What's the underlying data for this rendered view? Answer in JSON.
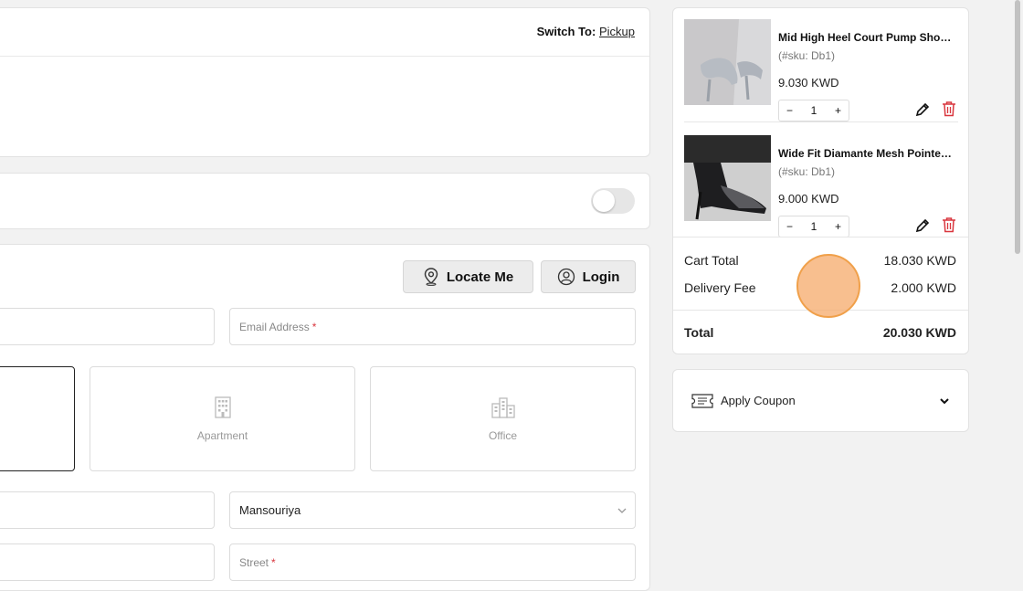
{
  "delivery": {
    "switch_label": "Switch To:",
    "switch_link": "Pickup"
  },
  "address": {
    "locate_label": "Locate Me",
    "login_label": "Login",
    "email_placeholder": "Email Address",
    "required_mark": "*",
    "types": [
      {
        "label": "Apartment",
        "icon": "apartment-icon"
      },
      {
        "label": "Office",
        "icon": "office-icon"
      }
    ],
    "area_value": "Mansouriya",
    "street_placeholder": "Street"
  },
  "cart": {
    "items": [
      {
        "name": "Mid High Heel Court Pump Shoes With Glitter",
        "sku": "(#sku: Db1)",
        "price": "9.030 KWD",
        "qty": "1"
      },
      {
        "name": "Wide Fit Diamante Mesh Pointed Court Shoes",
        "sku": "(#sku: Db1)",
        "price": "9.000 KWD",
        "qty": "1"
      }
    ],
    "cart_total_label": "Cart Total",
    "cart_total_value": "18.030 KWD",
    "delivery_fee_label": "Delivery Fee",
    "delivery_fee_value": "2.000 KWD",
    "total_label": "Total",
    "total_value": "20.030 KWD"
  },
  "coupon": {
    "label": "Apply Coupon"
  },
  "colors": {
    "accent_red": "#d9363e",
    "touch_orange": "#f0a04a"
  }
}
